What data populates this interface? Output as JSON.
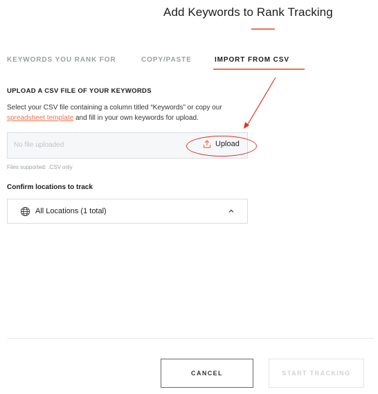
{
  "modal": {
    "title": "Add Keywords to Rank Tracking"
  },
  "tabs": [
    {
      "label": "KEYWORDS YOU RANK FOR",
      "active": false
    },
    {
      "label": "COPY/PASTE",
      "active": false
    },
    {
      "label": "IMPORT FROM CSV",
      "active": true
    }
  ],
  "upload_section": {
    "heading": "UPLOAD A CSV FILE OF YOUR KEYWORDS",
    "desc_before": "Select your CSV file containing a column titled “Keywords” or copy our ",
    "desc_link": "spreadsheet template",
    "desc_after": " and fill in your own keywords for upload.",
    "file_placeholder": "No file uploaded",
    "upload_label": "Upload",
    "upload_icon": "upload-icon",
    "files_supported": "Files supported: .CSV only"
  },
  "locations": {
    "label": "Confirm locations to track",
    "selected": "All Locations (1 total)",
    "icon": "globe-icon"
  },
  "footer": {
    "cancel_label": "CANCEL",
    "start_label": "START TRACKING"
  },
  "colors": {
    "accent": "#f2704b",
    "annotation_red": "#e0302e",
    "muted": "#9aa0a3"
  }
}
